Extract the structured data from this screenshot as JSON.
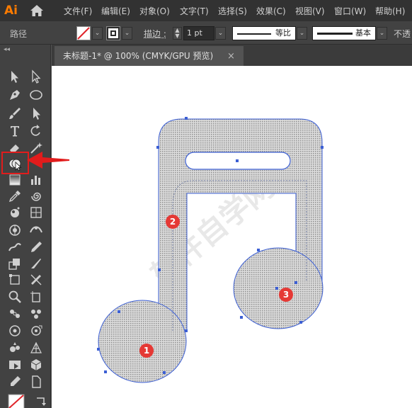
{
  "app": {
    "logo_text": "Ai",
    "brand_color": "#ff7c00"
  },
  "menu": {
    "items": [
      "文件(F)",
      "编辑(E)",
      "对象(O)",
      "文字(T)",
      "选择(S)",
      "效果(C)",
      "视图(V)",
      "窗口(W)",
      "帮助(H)"
    ]
  },
  "controlbar": {
    "path_label": "路径",
    "stroke_label": "描边 :",
    "stroke_value": "1 pt",
    "profile_label": "等比",
    "brush_label": "基本",
    "opacity_label": "不透"
  },
  "document": {
    "tab_title": "未标题-1* @ 100% (CMYK/GPU 预览)",
    "close_glyph": "×"
  },
  "markers": [
    "1",
    "2",
    "3"
  ],
  "colors": {
    "selection": "#3c5fd4",
    "highlight": "#e11c1c",
    "marker": "#e53935"
  },
  "tools": [
    "selection-tool-icon",
    "direct-selection-tool-icon",
    "magic-wand-tool-icon",
    "lasso-tool-icon",
    "pen-tool-icon",
    "ellipse-tool-icon",
    "paintbrush-tool-icon",
    "pencil-tool-icon",
    "type-tool-icon",
    "rotate-tool-icon",
    "eraser-tool-icon",
    "puppet-warp-tool-icon",
    "shape-builder-tool-icon",
    "perspective-grid-tool-icon",
    "gradient-tool-icon",
    "column-graph-tool-icon",
    "eyedropper-tool-icon",
    "blend-tool-icon",
    "symbol-sprayer-tool-icon",
    "mesh-tool-icon",
    "live-paint-tool-icon",
    "width-tool-icon",
    "warp-tool-icon",
    "curvature-tool-icon",
    "scale-tool-icon",
    "knife-tool-icon",
    "zoom-tool-icon",
    "artboard-tool-icon",
    "fill-stroke-swatch-icon",
    "swap-icon"
  ]
}
